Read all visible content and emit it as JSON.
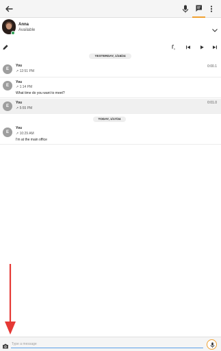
{
  "contact": {
    "name": "Anna",
    "status": "Available"
  },
  "conversation": {
    "day_separators": [
      "YESTERDAY, 1/16/24",
      "TODAY, 1/17/24"
    ],
    "messages": [
      {
        "avatar_letter": "E",
        "sender": "You",
        "time": "↗ 12:51 PM",
        "body": "",
        "duration": "0:00.1"
      },
      {
        "avatar_letter": "E",
        "sender": "You",
        "time": "↗ 1:14 PM",
        "body": "What time do you want to meet?",
        "duration": ""
      },
      {
        "avatar_letter": "E",
        "sender": "You",
        "time": "↗ 5:55 PM",
        "body": "",
        "duration": "0:01.0"
      },
      {
        "avatar_letter": "E",
        "sender": "You",
        "time": "↗ 10:29 AM",
        "body": "I'm at the main office",
        "duration": ""
      }
    ]
  },
  "composer": {
    "placeholder": "Type a message"
  },
  "icons": {
    "back": "arrow-back-icon",
    "mic": "mic-icon",
    "messages": "chat-icon",
    "more": "more-vert-icon",
    "expand": "chevron-down-icon",
    "edit": "pencil-icon",
    "speed": "playback-speed-icon",
    "previous": "skip-previous-icon",
    "play": "play-icon",
    "next": "skip-next-icon",
    "camera": "camera-icon",
    "compose_mic": "mic-icon"
  },
  "colors": {
    "accent": "#f0a030",
    "presence": "#2e9e55",
    "annotation": "#e53935",
    "input_underline": "#5aa0e8"
  }
}
